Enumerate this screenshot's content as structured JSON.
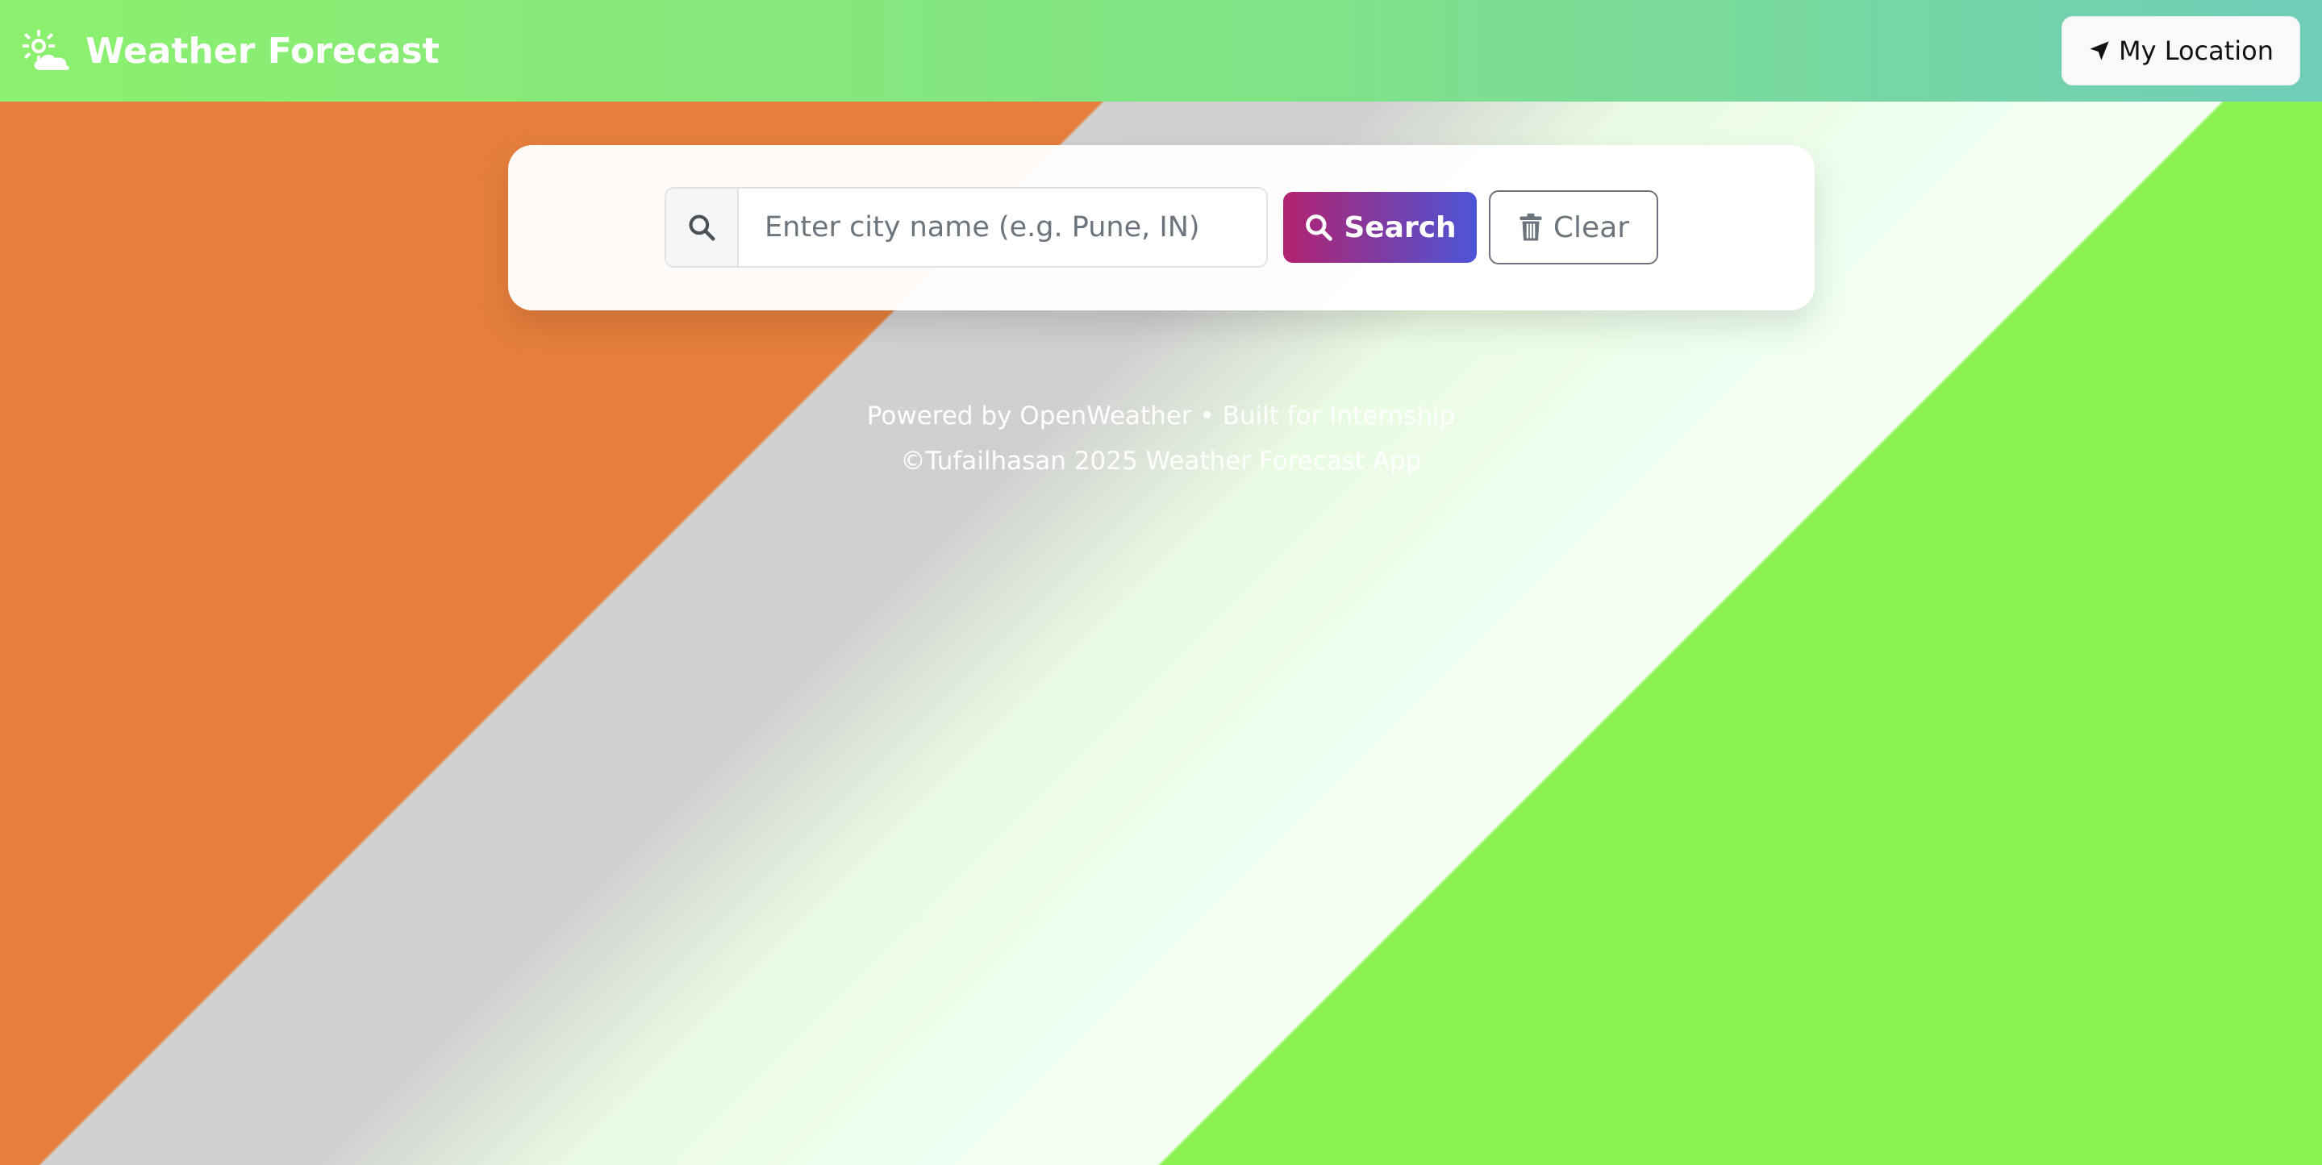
{
  "header": {
    "title": "Weather Forecast",
    "brand_icon": "sun-cloud-icon",
    "location_button": {
      "label": "My Location",
      "icon": "location-arrow-icon"
    }
  },
  "search": {
    "placeholder": "Enter city name (e.g. Pune, IN)",
    "value": "",
    "addon_icon": "search-icon",
    "search_button": {
      "label": "Search",
      "icon": "search-icon"
    },
    "clear_button": {
      "label": "Clear",
      "icon": "trash-icon"
    }
  },
  "footer": {
    "line1": "Powered by OpenWeather • Built for Internship",
    "line2": "©Tufailhasan 2025 Weather Forecast App"
  },
  "colors": {
    "header_start": "#8cf06e",
    "header_end": "#6fcdb9",
    "search_button_start": "#b2226f",
    "search_button_end": "#4c55d8",
    "bg_orange": "#e67f3c",
    "bg_green": "#8bf454"
  }
}
